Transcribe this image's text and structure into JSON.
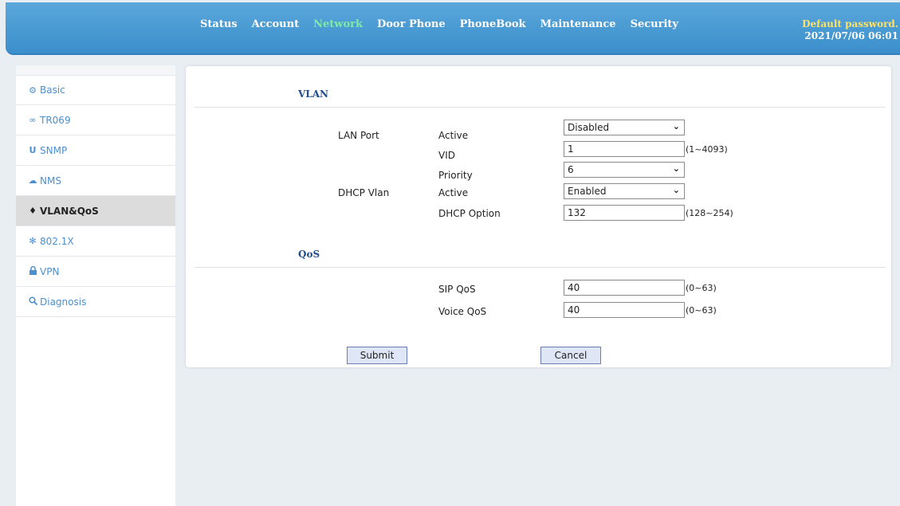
{
  "nav": {
    "items": [
      "Status",
      "Account",
      "Network",
      "Door Phone",
      "PhoneBook",
      "Maintenance",
      "Security"
    ],
    "active": "Network"
  },
  "header": {
    "warning": "Default password.",
    "datetime": "2021/07/06 06:01"
  },
  "sidebar": {
    "items": [
      {
        "label": "Basic",
        "icon": "gear-people-icon"
      },
      {
        "label": "TR069",
        "icon": "link-icon"
      },
      {
        "label": "SNMP",
        "icon": "snmp-icon"
      },
      {
        "label": "NMS",
        "icon": "cloud-icon"
      },
      {
        "label": "VLAN&QoS",
        "icon": "pin-icon"
      },
      {
        "label": "802.1X",
        "icon": "asterisk-icon"
      },
      {
        "label": "VPN",
        "icon": "lock-icon"
      },
      {
        "label": "Diagnosis",
        "icon": "magnifier-icon"
      }
    ],
    "active": "VLAN&QoS"
  },
  "vlan": {
    "title": "VLAN",
    "lan_port": {
      "label": "LAN Port",
      "active_label": "Active",
      "active_value": "Disabled",
      "vid_label": "VID",
      "vid_value": "1",
      "vid_hint": "(1~4093)",
      "priority_label": "Priority",
      "priority_value": "6"
    },
    "dhcp_vlan": {
      "label": "DHCP Vlan",
      "active_label": "Active",
      "active_value": "Enabled",
      "option_label": "DHCP Option",
      "option_value": "132",
      "option_hint": "(128~254)"
    }
  },
  "qos": {
    "title": "QoS",
    "sip_label": "SIP QoS",
    "sip_value": "40",
    "sip_hint": "(0~63)",
    "voice_label": "Voice QoS",
    "voice_value": "40",
    "voice_hint": "(0~63)"
  },
  "actions": {
    "submit": "Submit",
    "cancel": "Cancel"
  },
  "colors": {
    "header_blue": "#3b8fcb",
    "nav_active": "#7fe9a8",
    "warning": "#ffe266",
    "sidebar_link": "#4a90d1",
    "section_title": "#1f4e8c"
  }
}
